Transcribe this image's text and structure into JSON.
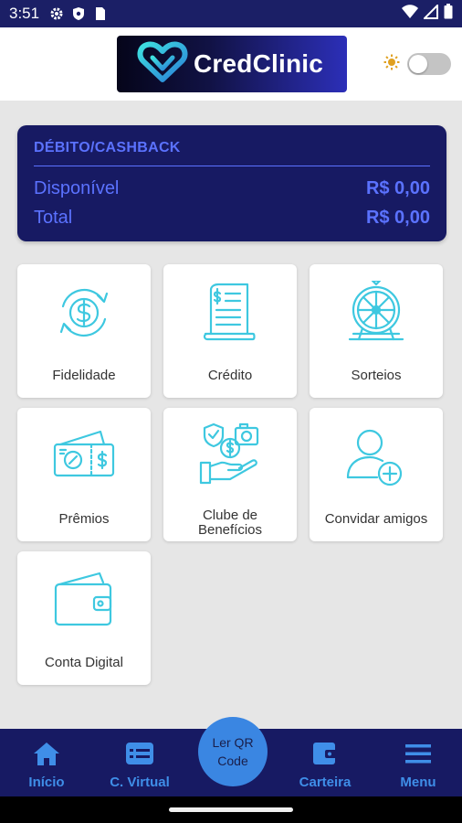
{
  "status_bar": {
    "time": "3:51"
  },
  "header": {
    "logo_text": "CredClinic"
  },
  "balance_card": {
    "title": "DÉBITO/CASHBACK",
    "rows": [
      {
        "label": "Disponível",
        "value": "R$ 0,00"
      },
      {
        "label": "Total",
        "value": "R$ 0,00"
      }
    ]
  },
  "tiles": [
    {
      "label": "Fidelidade",
      "icon": "dollar-cycle-icon"
    },
    {
      "label": "Crédito",
      "icon": "receipt-icon"
    },
    {
      "label": "Sorteios",
      "icon": "lottery-wheel-icon"
    },
    {
      "label": "Prêmios",
      "icon": "tickets-icon"
    },
    {
      "label_line1": "Clube de",
      "label_line2": "Benefícios",
      "icon": "benefits-hand-icon"
    },
    {
      "label": "Convidar amigos",
      "icon": "add-user-icon"
    },
    {
      "label": "Conta Digital",
      "icon": "wallet-icon"
    }
  ],
  "bottom_nav": {
    "items": [
      {
        "label": "Início",
        "icon": "home-icon"
      },
      {
        "label": "C. Virtual",
        "icon": "card-icon"
      },
      {
        "label": "Carteira",
        "icon": "wallet-icon"
      },
      {
        "label": "Menu",
        "icon": "menu-icon"
      }
    ],
    "qr_line1": "Ler QR",
    "qr_line2": "Code"
  },
  "colors": {
    "primary_dark": "#171a63",
    "accent_blue": "#3a86e2",
    "icon_cyan": "#3ec8e0",
    "card_text": "#5b72ff"
  }
}
